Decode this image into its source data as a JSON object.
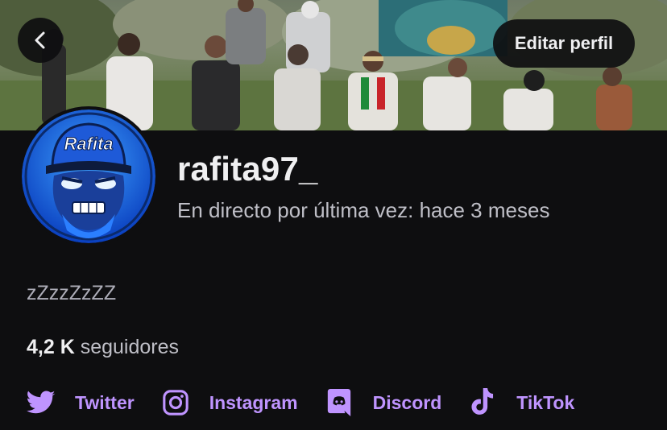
{
  "header": {
    "back_icon": "chevron-left-icon",
    "edit_profile_label": "Editar perfil"
  },
  "profile": {
    "username": "rafita97_",
    "last_live": "En directo por última vez: hace 3 meses",
    "bio": "zZzzZzZZ",
    "followers_count": "4,2 K",
    "followers_label": "seguidores",
    "avatar_text": "Rafita"
  },
  "socials": [
    {
      "label": "Twitter",
      "icon": "twitter-icon"
    },
    {
      "label": "Instagram",
      "icon": "instagram-icon"
    },
    {
      "label": "Discord",
      "icon": "discord-icon"
    },
    {
      "label": "TikTok",
      "icon": "tiktok-icon"
    }
  ],
  "colors": {
    "background": "#0e0e10",
    "accent": "#bf94ff",
    "text_primary": "#efeff1",
    "text_secondary": "#adadb8"
  }
}
